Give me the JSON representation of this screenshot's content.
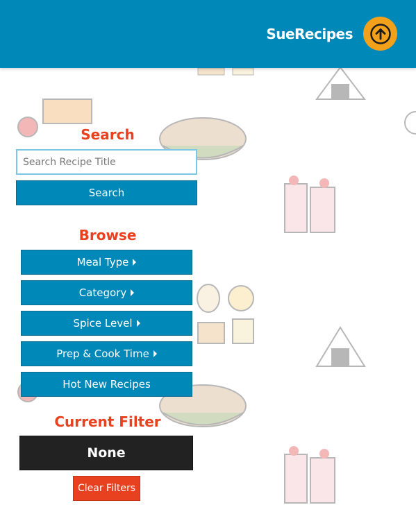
{
  "header": {
    "brand": "SueRecipes",
    "up_icon": "arrow-up-circle-icon",
    "brand_color": "#0088b8",
    "accent_color": "#f3a11b"
  },
  "search": {
    "heading": "Search",
    "placeholder": "Search Recipe Title",
    "value": "",
    "button_label": "Search"
  },
  "browse": {
    "heading": "Browse",
    "items": [
      {
        "label": "Meal Type",
        "has_caret": true
      },
      {
        "label": "Category",
        "has_caret": true
      },
      {
        "label": "Spice Level",
        "has_caret": true
      },
      {
        "label": "Prep & Cook Time",
        "has_caret": true
      },
      {
        "label": "Hot New Recipes",
        "has_caret": false
      }
    ]
  },
  "filter": {
    "heading": "Current Filter",
    "value": "None",
    "clear_label": "Clear Filters"
  },
  "colors": {
    "heading": "#e8411f",
    "button": "#0088b8",
    "filter_box": "#222222",
    "clear": "#e8411f"
  }
}
